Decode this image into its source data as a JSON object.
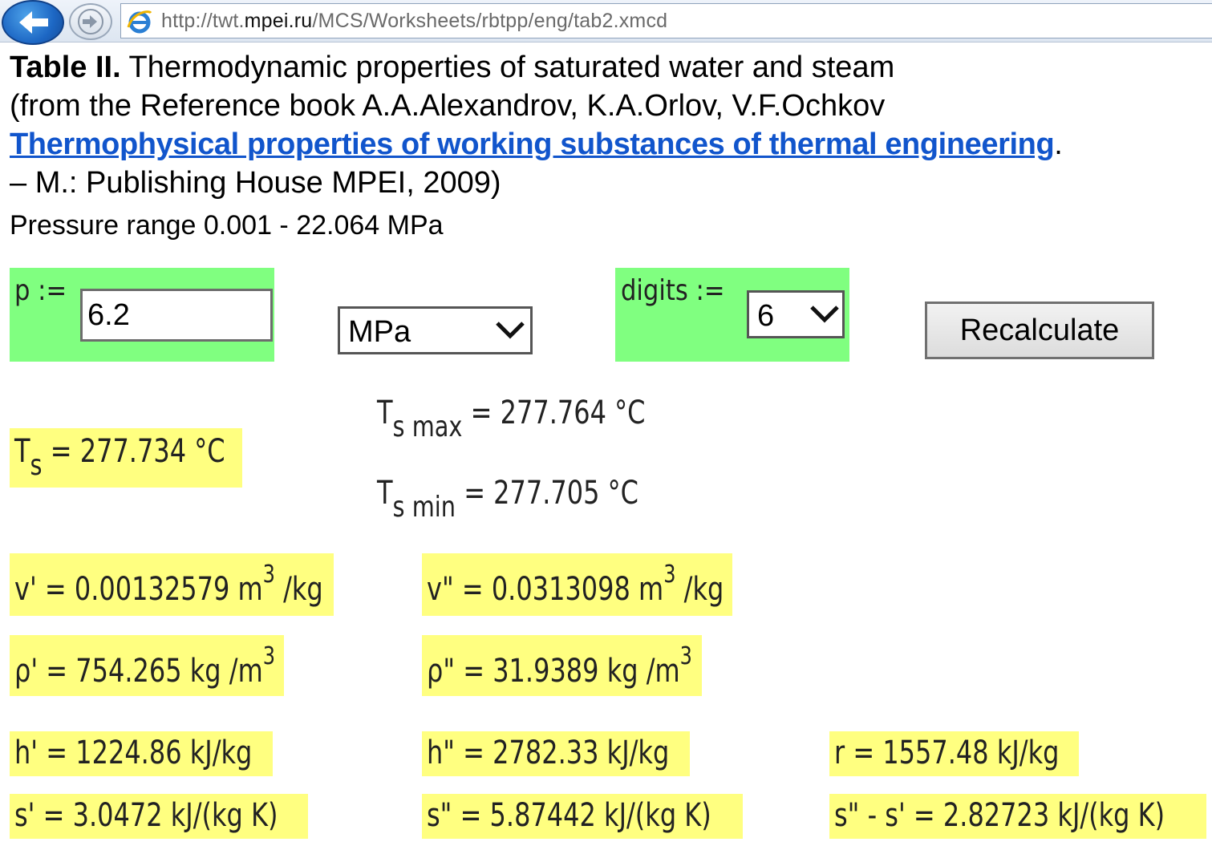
{
  "browser": {
    "url_prefix": "http://twt.",
    "url_domain": "mpei.ru",
    "url_path": "/MCS/Worksheets/rbtpp/eng/tab2.xmcd"
  },
  "header": {
    "table_label": "Table II.",
    "title": " Thermodynamic properties of saturated water and steam",
    "source_line": "(from the Reference book A.A.Alexandrov, K.A.Orlov, V.F.Ochkov",
    "book_link": "Thermophysical properties of working substances of thermal engineering",
    "book_link_suffix": ".",
    "publisher_line": "– M.: Publishing House MPEI, 2009)",
    "range": "Pressure range 0.001 - 22.064 MPa"
  },
  "inputs": {
    "p_label": "p  :=",
    "p_value": "6.2",
    "unit_selected": "MPa",
    "digits_label": "digits  :=",
    "digits_selected": "6",
    "recalculate_label": "Recalculate"
  },
  "results": {
    "ts": {
      "symbol": "T",
      "subscript": "s",
      "rest": " = 277.734 °C"
    },
    "ts_max": {
      "symbol": "T",
      "subscript": "s max",
      "rest": " = 277.764 °C"
    },
    "ts_min": {
      "symbol": "T",
      "subscript": "s min",
      "rest": " = 277.705 °C"
    },
    "v1": {
      "pre": "v' = 0.00132579 m",
      "sup": "3",
      "post": " /kg"
    },
    "v2": {
      "pre": "v\" = 0.0313098 m",
      "sup": "3",
      "post": " /kg"
    },
    "rho1": {
      "pre": "ρ' = 754.265 kg /m",
      "sup": "3"
    },
    "rho2": {
      "pre": "ρ\" = 31.9389 kg /m",
      "sup": "3"
    },
    "h1": "h' = 1224.86 kJ/kg",
    "h2": "h\" = 2782.33 kJ/kg",
    "r": "r = 1557.48 kJ/kg",
    "s1": "s' = 3.0472 kJ/(kg K)",
    "s2": "s\" = 5.87442 kJ/(kg K)",
    "sdiff": "s\" - s' = 2.82723 kJ/(kg K)"
  },
  "colors": {
    "input_panel": "#80ff80",
    "result_highlight": "#ffff80",
    "link": "#1155cc"
  },
  "icons": {
    "back": "back-arrow-icon",
    "forward": "forward-arrow-icon",
    "browser": "ie-logo-icon",
    "dropdown": "chevron-down-icon"
  }
}
